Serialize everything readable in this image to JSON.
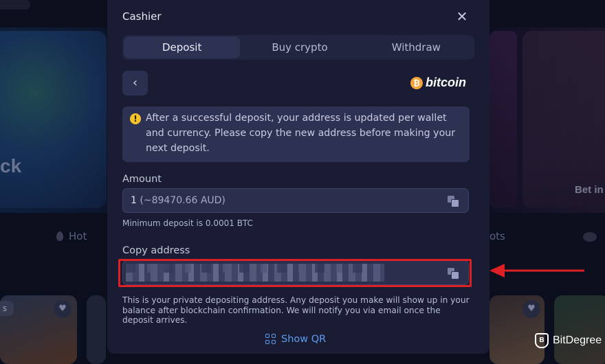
{
  "background": {
    "promo_text": "ck",
    "promo_text_right": "Bet in",
    "nav_items": [
      "Hot",
      "ots"
    ],
    "tag_text": "s",
    "heart_glyph": "♥"
  },
  "modal": {
    "title": "Cashier",
    "close_glyph": "✕",
    "tabs": [
      {
        "label": "Deposit",
        "active": true
      },
      {
        "label": "Buy crypto",
        "active": false
      },
      {
        "label": "Withdraw",
        "active": false
      }
    ],
    "back_glyph": "‹",
    "currency": {
      "symbol": "₿",
      "name": "bitcoin",
      "color": "#f2a33a"
    },
    "notice": {
      "icon": "!",
      "text": "After a successful deposit, your address is updated per wallet and currency. Please copy the new address before making your next deposit."
    },
    "amount": {
      "label": "Amount",
      "value": "1",
      "converted": "(~89470.66 AUD)",
      "hint": "Minimum deposit is 0.0001 BTC"
    },
    "address": {
      "label": "Copy address",
      "value_obscured": true
    },
    "info": "This is your private depositing address. Any deposit you make will show up in your balance after blockchain confirmation. We will notify you via email once the deposit arrives.",
    "show_qr_label": "Show QR"
  },
  "overlay": {
    "highlight_color": "#dc2023",
    "watermark": "BitDegree",
    "watermark_icon": "B"
  }
}
